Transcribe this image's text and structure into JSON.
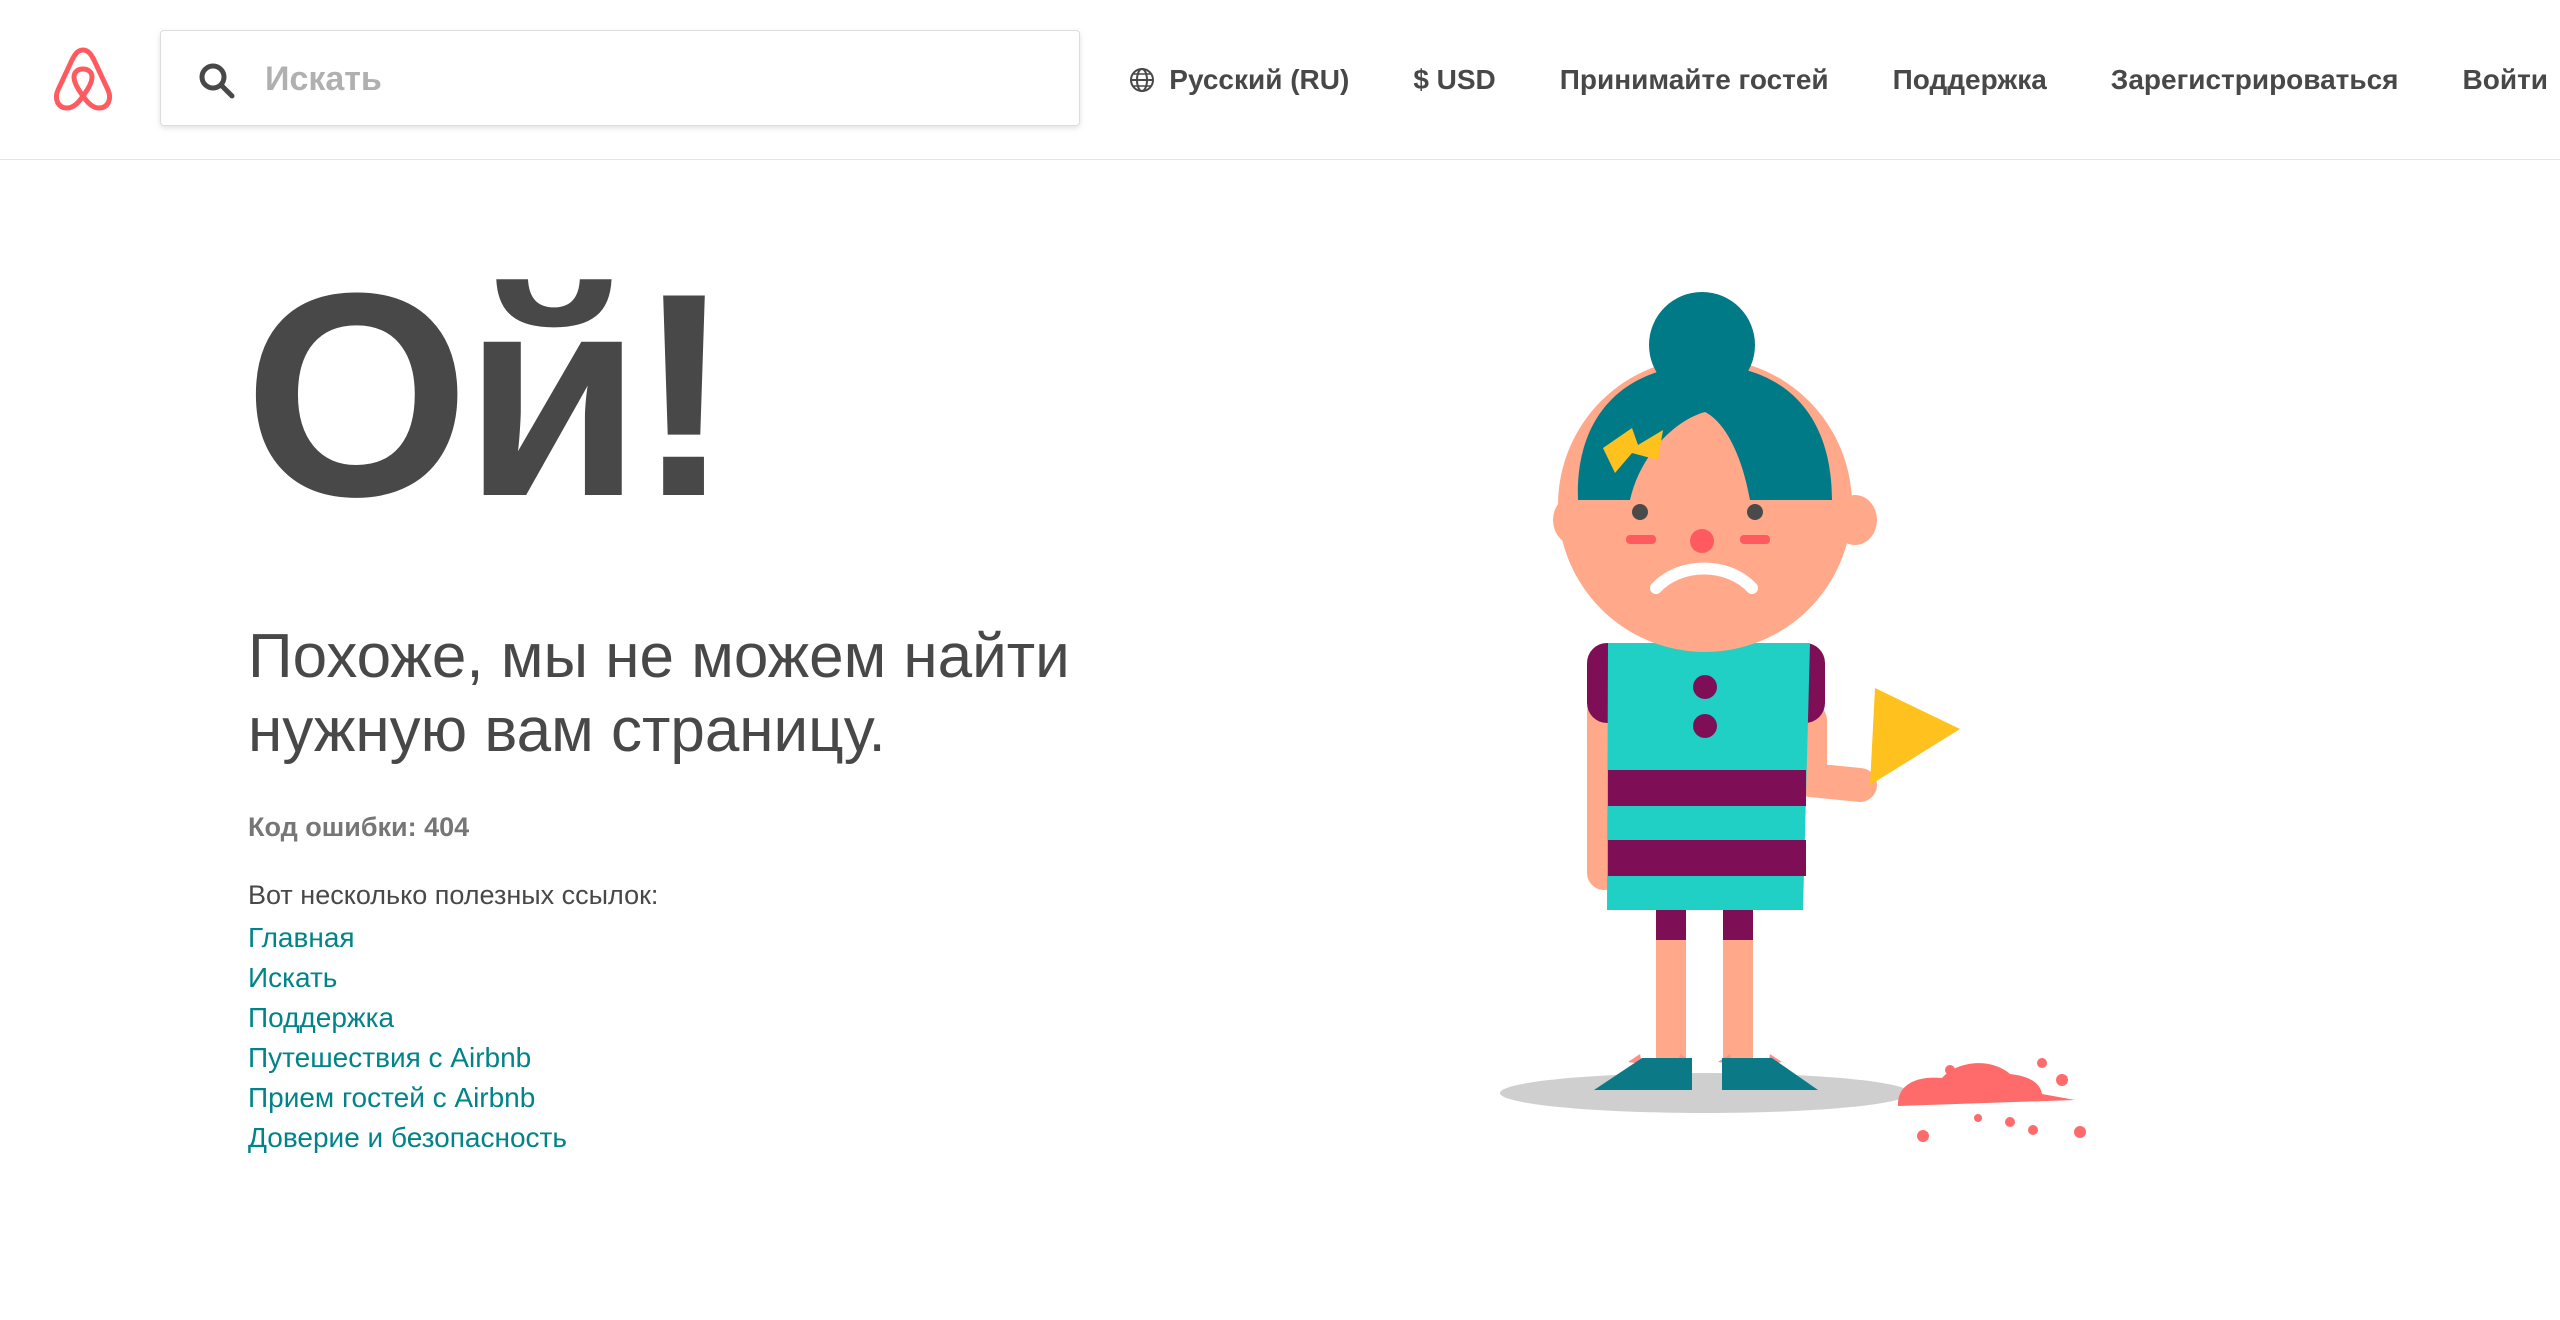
{
  "header": {
    "search": {
      "placeholder": "Искать"
    },
    "nav": {
      "language": "Русский (RU)",
      "currency": "$ USD",
      "host": "Принимайте гостей",
      "help": "Поддержка",
      "signup": "Зарегистрироваться",
      "login": "Войти"
    }
  },
  "main": {
    "title": "Ой!",
    "subtitle_line1": "Похоже, мы не можем найти",
    "subtitle_line2": "нужную вам страницу.",
    "error_code": "Код ошибки: 404",
    "links_intro": "Вот несколько полезных ссылок:",
    "links": [
      "Главная",
      "Искать",
      "Поддержка",
      "Путешествия с Airbnb",
      "Прием гостей с Airbnb",
      "Доверие и безопасность"
    ]
  },
  "colors": {
    "brand": "#ff5a5f",
    "link": "#008489",
    "text": "#484848"
  },
  "icons": {
    "logo": "airbnb-belo-logo",
    "search": "search-icon",
    "language": "globe-icon"
  }
}
